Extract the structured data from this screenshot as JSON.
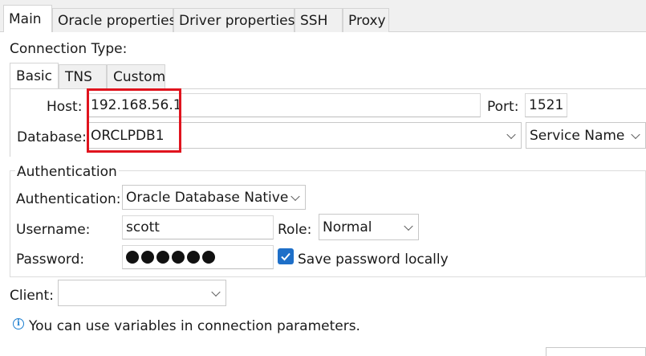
{
  "main_tabs": [
    {
      "label": "Main",
      "active": true
    },
    {
      "label": "Oracle properties",
      "active": false
    },
    {
      "label": "Driver properties",
      "active": false
    },
    {
      "label": "SSH",
      "active": false
    },
    {
      "label": "Proxy",
      "active": false
    }
  ],
  "connection_type": {
    "label": "Connection Type:",
    "tabs": [
      {
        "label": "Basic",
        "active": true
      },
      {
        "label": "TNS",
        "active": false
      },
      {
        "label": "Custom",
        "active": false
      }
    ]
  },
  "basic": {
    "host_label": "Host:",
    "host_value": "192.168.56.1",
    "port_label": "Port:",
    "port_value": "1521",
    "database_label": "Database:",
    "database_value": "ORCLPDB1",
    "database_type_value": "Service Name"
  },
  "authentication": {
    "group_title": "Authentication",
    "auth_label": "Authentication:",
    "auth_value": "Oracle Database Native",
    "username_label": "Username:",
    "username_value": "scott",
    "role_label": "Role:",
    "role_value": "Normal",
    "password_label": "Password:",
    "password_mask_count": 6,
    "save_password_label": "Save password locally",
    "save_password_checked": true
  },
  "client": {
    "label": "Client:",
    "value": ""
  },
  "info": {
    "text": "You can use variables in connection parameters."
  },
  "colors": {
    "highlight": "#e0141e",
    "checkbox": "#1e6fc8",
    "info_icon": "#1e7fd0"
  }
}
